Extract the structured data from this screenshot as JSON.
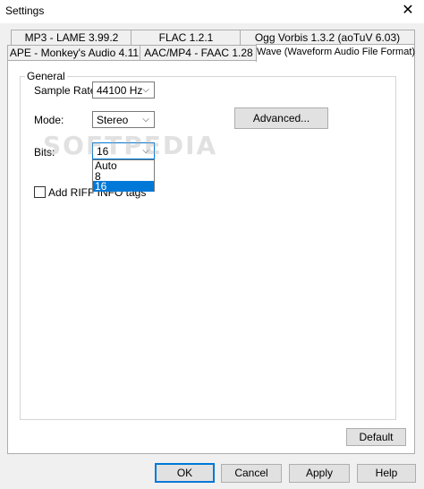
{
  "window": {
    "title": "Settings",
    "close_glyph": "✕"
  },
  "tabs_row1": [
    {
      "label": "MP3 - LAME 3.99.2"
    },
    {
      "label": "FLAC 1.2.1"
    },
    {
      "label": "Ogg Vorbis 1.3.2 (aoTuV 6.03)"
    }
  ],
  "tabs_row2": [
    {
      "label": "APE - Monkey's Audio 4.11"
    },
    {
      "label": "AAC/MP4 - FAAC 1.28"
    },
    {
      "label": "Wave (Waveform Audio File Format)",
      "active": true
    }
  ],
  "general": {
    "group_label": "General",
    "sample_rate_label": "Sample Rate:",
    "sample_rate_value": "44100 Hz",
    "mode_label": "Mode:",
    "mode_value": "Stereo",
    "bits_label": "Bits:",
    "bits_value": "16",
    "bits_options": [
      "Auto",
      "8",
      "16"
    ],
    "bits_selected": "16",
    "advanced_label": "Advanced...",
    "riff_label": "Add RIFF INFO tags",
    "riff_checked": false
  },
  "default_button": "Default",
  "footer": {
    "ok": "OK",
    "cancel": "Cancel",
    "apply": "Apply",
    "help": "Help"
  },
  "watermark_text": "SOFTPEDIA",
  "icons": {
    "dropdown_arrow": "chevron-down-icon",
    "close": "close-icon"
  },
  "colors": {
    "accent": "#0078d7",
    "selection": "#0078d7"
  }
}
